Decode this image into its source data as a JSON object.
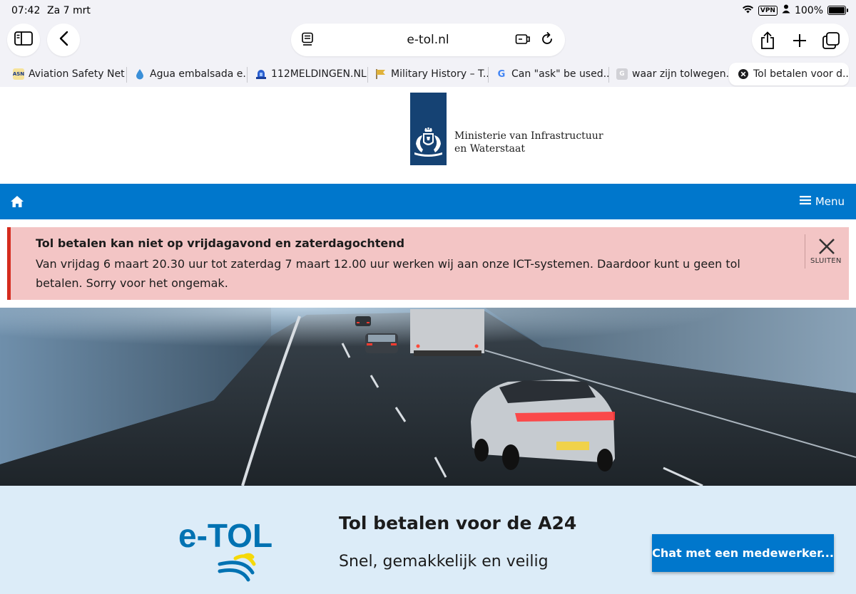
{
  "status_bar": {
    "time": "07:42",
    "date": "Za 7 mrt",
    "vpn": "VPN",
    "battery_label": "100%",
    "battery_level": 1.0
  },
  "browser": {
    "url": "e-tol.nl",
    "tabs": [
      {
        "label": "Aviation Safety Net...",
        "favicon": "ASN",
        "active": false
      },
      {
        "label": "Agua embalsada e...",
        "favicon": "water-drop-icon",
        "active": false
      },
      {
        "label": "112MELDINGEN.NL...",
        "favicon": "siren-icon",
        "active": false
      },
      {
        "label": "Military History – T...",
        "favicon": "flag-icon",
        "active": false
      },
      {
        "label": "Can \"ask\" be used...",
        "favicon": "G",
        "active": false
      },
      {
        "label": "waar zijn tolwegen...",
        "favicon": "G",
        "active": false
      },
      {
        "label": "Tol betalen voor d...",
        "favicon": "close-icon",
        "active": true
      }
    ]
  },
  "site": {
    "ministry_line1": "Ministerie van Infrastructuur",
    "ministry_line2": "en Waterstaat",
    "menu_label": "Menu",
    "alert": {
      "title": "Tol betalen kan niet op vrijdagavond en zaterdagochtend",
      "body": "Van vrijdag 6 maart 20.30 uur tot zaterdag 7 maart 12.00 uur werken wij aan onze ICT-systemen. Daardoor kunt u geen tol betalen. Sorry voor het ongemak.",
      "close_label": "SLUITEN"
    },
    "promo": {
      "logo_text": "e-TOL",
      "title": "Tol betalen voor de A24",
      "subtitle": "Snel, gemakkelijk en veilig",
      "chat_button": "Chat met een medewerker..."
    },
    "colors": {
      "nav_blue": "#0077cc",
      "alert_bg": "#f3c5c5",
      "alert_border": "#d52b1e",
      "promo_bg": "#dcecf8",
      "logo_blue": "#154273",
      "etol_blue": "#0072b2",
      "etol_yellow": "#f5d90a"
    }
  }
}
